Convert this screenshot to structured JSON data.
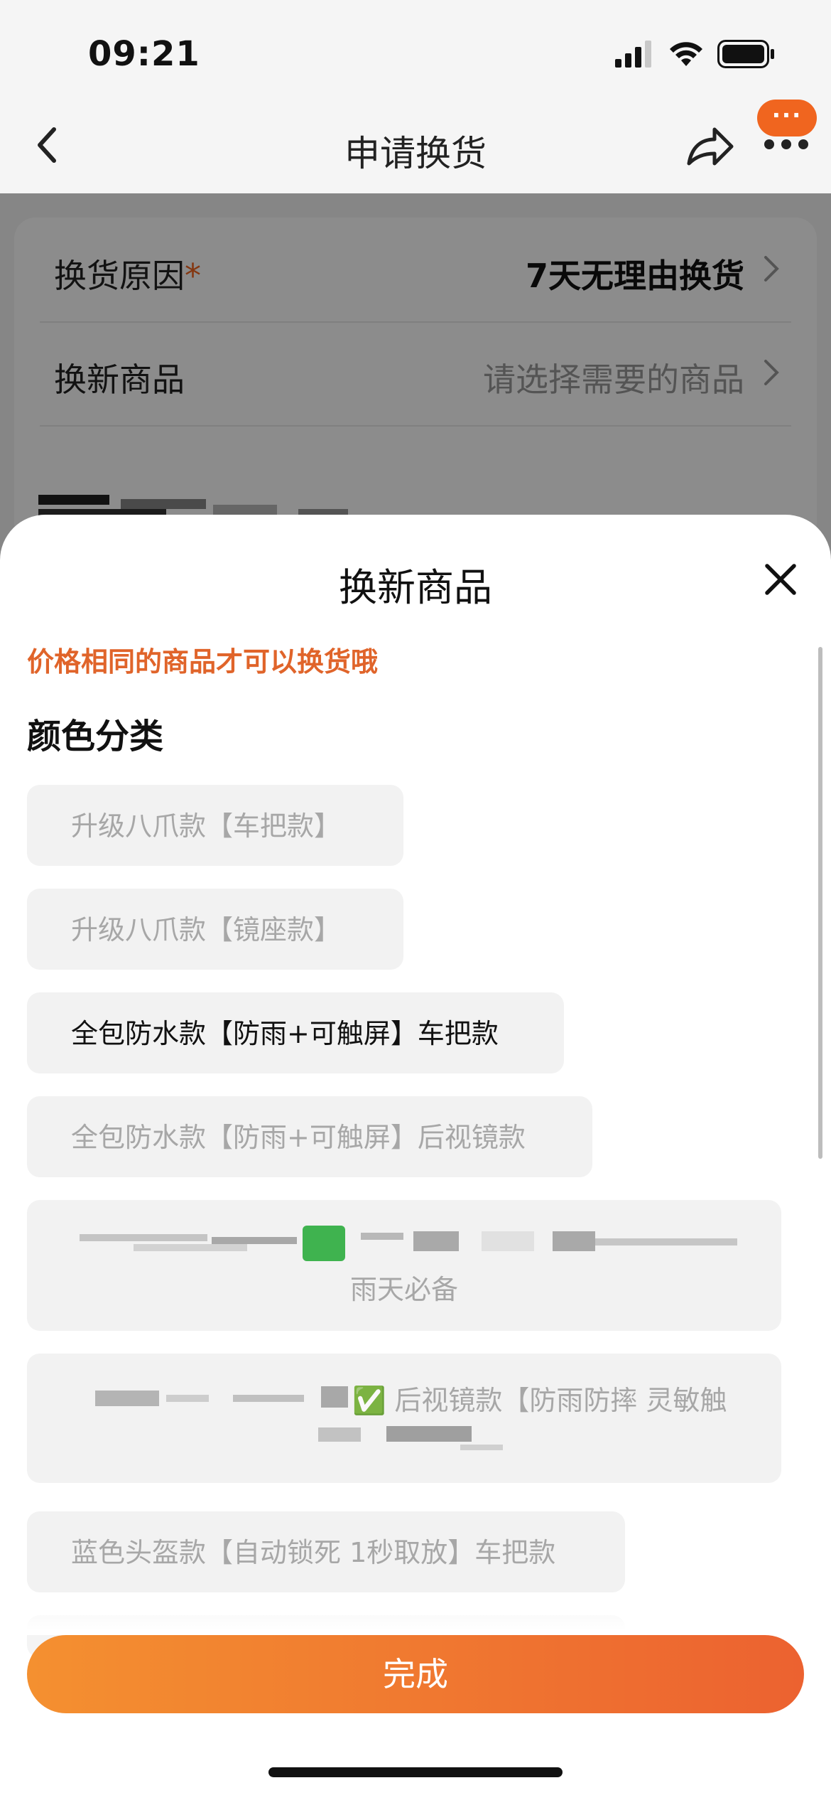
{
  "status_bar": {
    "time": "09:21",
    "icons": [
      "cellular-signal-icon",
      "wifi-icon",
      "battery-icon"
    ]
  },
  "nav": {
    "title": "申请换货",
    "back_icon": "chevron-left-icon",
    "share_icon": "share-icon",
    "more_label": "···"
  },
  "form": {
    "reason_label": "换货原因",
    "required_mark": "*",
    "reason_value": "7天无理由换货",
    "product_label": "换新商品",
    "product_placeholder": "请选择需要的商品"
  },
  "sheet": {
    "title": "换新商品",
    "close_icon": "close-icon",
    "notice": "价格相同的商品才可以换货哦",
    "section_title": "颜色分类",
    "options": [
      {
        "label": "升级八爪款【车把款】",
        "enabled": false
      },
      {
        "label": "升级八爪款【镜座款】",
        "enabled": false
      },
      {
        "label": "全包防水款【防雨+可触屏】车把款",
        "enabled": true
      },
      {
        "label": "全包防水款【防雨+可触屏】后视镜款",
        "enabled": false
      },
      {
        "label": "雨天必备",
        "enabled": false
      },
      {
        "label": "✅ 后视镜款【防雨防摔 灵敏触",
        "enabled": false
      },
      {
        "label": "蓝色头盔款【自动锁死 1秒取放】车把款",
        "enabled": false
      }
    ],
    "done_label": "完成"
  },
  "colors": {
    "accent": "#f0651f",
    "notice": "#e0642a",
    "button_start": "#f49030",
    "button_end": "#ec6230"
  }
}
